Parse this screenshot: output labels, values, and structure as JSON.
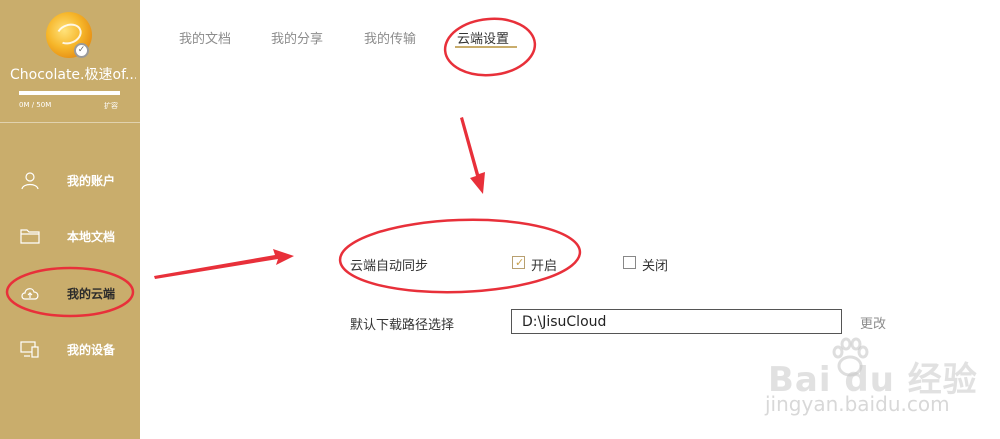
{
  "sidebar": {
    "username": "Chocolate.极速of...",
    "storage_text": "0M / 50M",
    "storage_fraction": 1.0,
    "expand_label": "扩容",
    "items": [
      {
        "label": "我的账户",
        "icon": "user-icon"
      },
      {
        "label": "本地文档",
        "icon": "folder-icon"
      },
      {
        "label": "我的云端",
        "icon": "cloud-upload-icon"
      },
      {
        "label": "我的设备",
        "icon": "device-icon"
      }
    ]
  },
  "tabs": [
    {
      "label": "我的文档"
    },
    {
      "label": "我的分享"
    },
    {
      "label": "我的传输"
    },
    {
      "label": "云端设置",
      "active": true
    }
  ],
  "settings": {
    "sync_label": "云端自动同步",
    "sync_on_label": "开启",
    "sync_off_label": "关闭",
    "sync_selected": "开启",
    "path_label": "默认下载路径选择",
    "path_value": "D:\\JisuCloud",
    "change_label": "更改"
  },
  "watermark": {
    "main": "Bai  du 经验",
    "sub": "jingyan.baidu.com"
  },
  "colors": {
    "sidebar_bg": "#c9ad6c",
    "annotation_red": "#e8303a",
    "accent": "#c9ad6c"
  }
}
